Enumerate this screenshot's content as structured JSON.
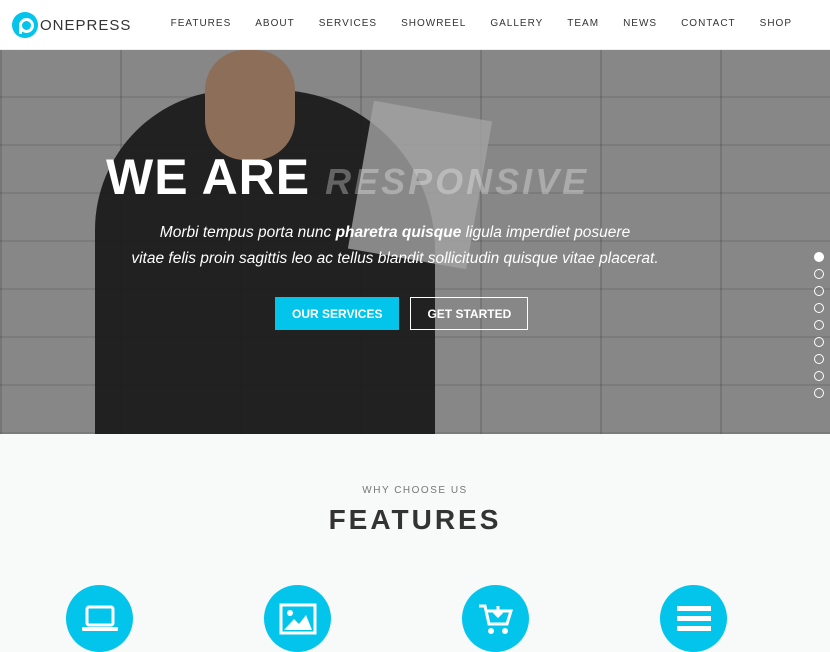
{
  "header": {
    "logo_text": "ONEPRESS",
    "nav": [
      "FEATURES",
      "ABOUT",
      "SERVICES",
      "SHOWREEL",
      "GALLERY",
      "TEAM",
      "NEWS",
      "CONTACT",
      "SHOP"
    ]
  },
  "hero": {
    "title_static": "WE ARE",
    "title_rotating": "RESPONSIVE",
    "subtitle_1": "Morbi tempus porta nunc ",
    "subtitle_bold": "pharetra quisque",
    "subtitle_2": " ligula imperdiet posuere",
    "subtitle_line2": "vitae felis proin sagittis leo ac tellus blandit sollicitudin quisque vitae placerat.",
    "primary_button": "OUR SERVICES",
    "secondary_button": "GET STARTED",
    "slide_count": 9,
    "active_slide": 1
  },
  "features": {
    "kicker": "WHY CHOOSE US",
    "title": "FEATURES",
    "icons": [
      "laptop-icon",
      "image-icon",
      "cart-download-icon",
      "bars-icon"
    ]
  },
  "colors": {
    "accent": "#03c4eb"
  }
}
